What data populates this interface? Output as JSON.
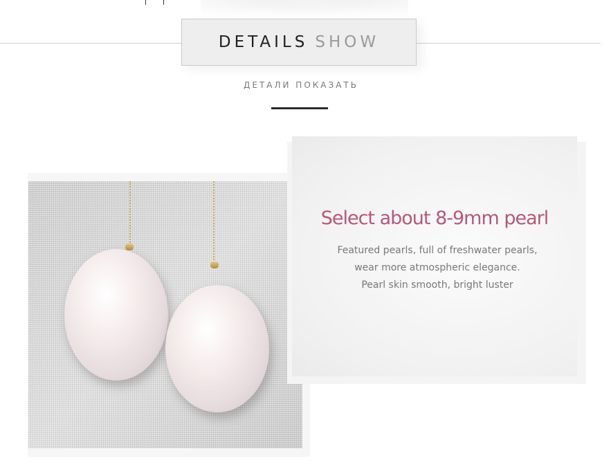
{
  "header": {
    "title_dark": "DETAILS",
    "title_light": "SHOW",
    "subtitle": "ДЕТАЛИ ПОКАЗАТЬ"
  },
  "feature": {
    "title": "Select about 8-9mm pearl",
    "lines": [
      "Featured pearls, full of freshwater pearls,",
      "wear more atmospheric elegance.",
      "Pearl skin smooth, bright luster"
    ]
  },
  "colors": {
    "accent": "#b5587a",
    "title_dark": "#1f1f1f",
    "title_light": "#9a9a9a",
    "body_text": "#777777"
  }
}
